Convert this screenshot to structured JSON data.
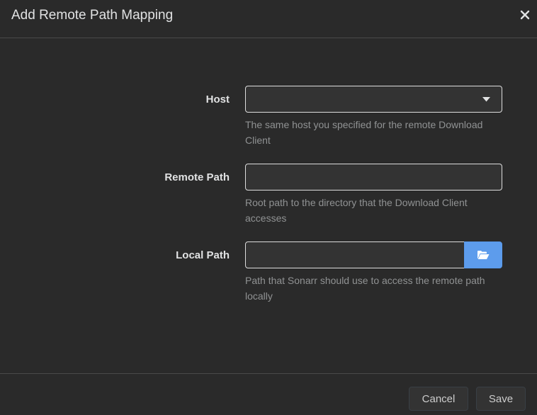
{
  "modal": {
    "title": "Add Remote Path Mapping",
    "close_icon": "close-icon"
  },
  "form": {
    "host": {
      "label": "Host",
      "value": "",
      "help": "The same host you specified for the remote Download Client",
      "icon": "caret-down-icon"
    },
    "remote_path": {
      "label": "Remote Path",
      "value": "",
      "help": "Root path to the directory that the Download Client accesses"
    },
    "local_path": {
      "label": "Local Path",
      "value": "",
      "help": "Path that Sonarr should use to access the remote path locally",
      "browse_icon": "folder-open-icon"
    }
  },
  "footer": {
    "cancel_label": "Cancel",
    "save_label": "Save"
  },
  "colors": {
    "background": "#2a2a2a",
    "input_bg": "#333333",
    "accent": "#5d9cec",
    "border": "#dddddd",
    "help_text": "#909293"
  }
}
